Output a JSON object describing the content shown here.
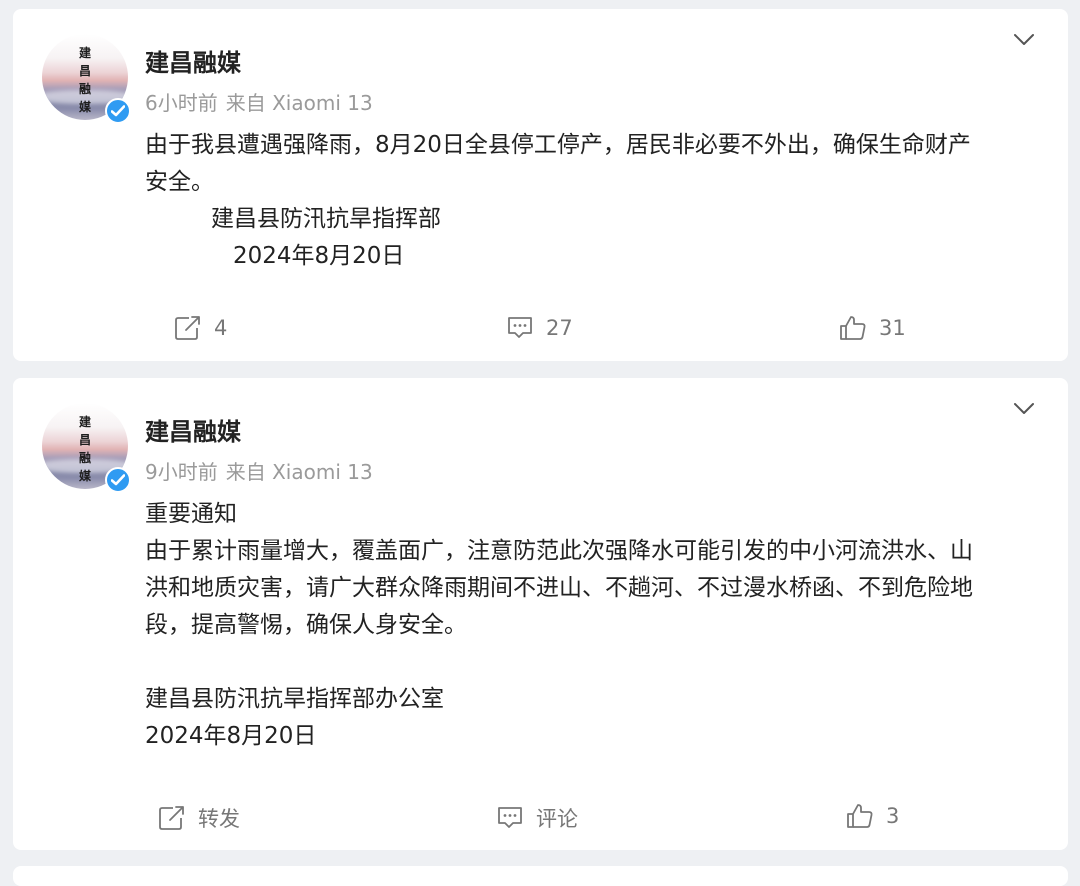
{
  "posts": [
    {
      "author": "建昌融媒",
      "avatar_text": [
        "建",
        "昌",
        "融",
        "媒"
      ],
      "time": "6小时前",
      "source": "来自 Xiaomi 13",
      "lines": [
        "由于我县遭遇强降雨，8月20日全县停工停产，居民非必要不外出，确保生命财产",
        "安全。",
        "建昌县防汛抗旱指挥部",
        "2024年8月20日"
      ],
      "actions": {
        "repost": "4",
        "comment": "27",
        "like": "31"
      }
    },
    {
      "author": "建昌融媒",
      "avatar_text": [
        "建",
        "昌",
        "融",
        "媒"
      ],
      "time": "9小时前",
      "source": "来自 Xiaomi 13",
      "lines": [
        "重要通知",
        "由于累计雨量增大，覆盖面广，注意防范此次强降水可能引发的中小河流洪水、山",
        "洪和地质灾害，请广大群众降雨期间不进山、不趟河、不过漫水桥函、不到危险地",
        "段，提高警惕，确保人身安全。",
        "建昌县防汛抗旱指挥部办公室",
        "2024年8月20日"
      ],
      "actions": {
        "repost": "转发",
        "comment": "评论",
        "like": "3"
      }
    }
  ],
  "icons": {
    "verified": "verified-badge-icon",
    "menu": "chevron-down-icon",
    "repost": "repost-icon",
    "comment": "comment-icon",
    "like": "thumbs-up-icon"
  },
  "colors": {
    "background": "#eef0f3",
    "card": "#ffffff",
    "verified_blue": "#2f9bf2",
    "meta_gray": "#9a9a9a",
    "text": "#222222"
  }
}
